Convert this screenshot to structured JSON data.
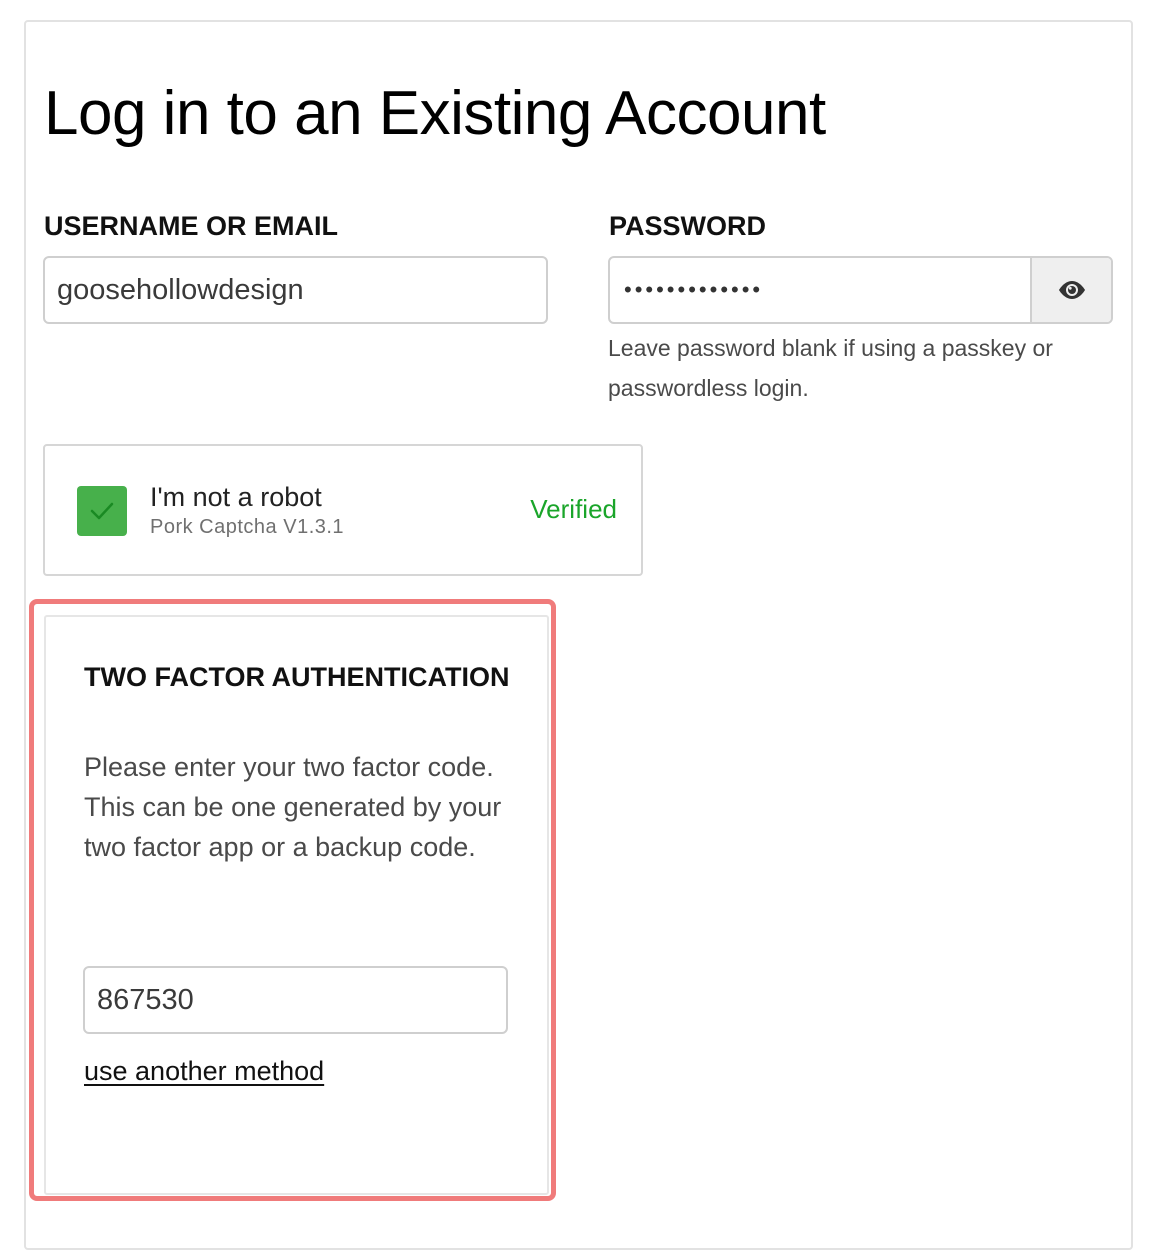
{
  "page": {
    "title": "Log in to an Existing Account"
  },
  "login": {
    "username_label": "USERNAME OR EMAIL",
    "username_value": "goosehollowdesign",
    "password_label": "PASSWORD",
    "password_value": "•••••••••••••",
    "password_help": "Leave password blank if using a passkey or passwordless login.",
    "visibility_toggle_icon": "eye-icon"
  },
  "captcha": {
    "label": "I'm not a robot",
    "provider": "Pork Captcha V1.3.1",
    "status": "Verified",
    "checked": true,
    "check_color": "#47b04b",
    "status_color": "#1aa52a"
  },
  "two_factor": {
    "heading": "TWO FACTOR AUTHENTICATION",
    "description": "Please enter your two factor code. This can be one generated by your two factor app or a backup code.",
    "code_value": "867530",
    "alt_method_link": "use another method",
    "highlight_color": "#f07b7b"
  }
}
